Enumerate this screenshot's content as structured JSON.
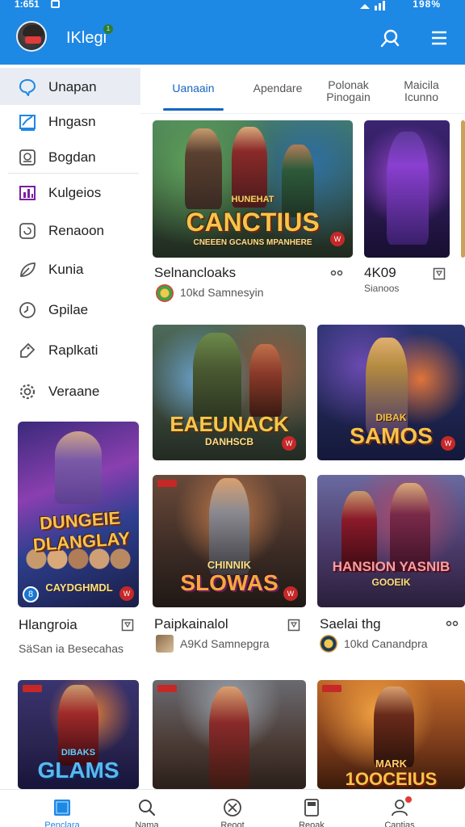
{
  "status_bar": {
    "time": "1:651",
    "battery": "198%"
  },
  "app_bar": {
    "app_name": "IKlegi",
    "badge": "1"
  },
  "sidebar": {
    "items": [
      {
        "label": "Unapan",
        "icon": "chat-bubble-icon",
        "active": true
      },
      {
        "label": "Hngasn",
        "icon": "edit-chart-icon"
      },
      {
        "label": "Bogdan",
        "icon": "image-frame-icon"
      },
      {
        "label": "Kulgeios",
        "icon": "bar-chart-icon"
      },
      {
        "label": "Renaoon",
        "icon": "refresh-square-icon"
      },
      {
        "label": "Kunia",
        "icon": "leaf-icon"
      },
      {
        "label": "Gpilae",
        "icon": "timer-icon"
      },
      {
        "label": "Raplkati",
        "icon": "tag-icon"
      },
      {
        "label": "Veraane",
        "icon": "gear-icon"
      }
    ],
    "card": {
      "art_title": "DUNGEIE DLANGLAY",
      "art_subtitle": "CAYDGHMDL",
      "badge_left": "8",
      "title": "Hlangroia",
      "subtitle": "SäSan ia Besecahas"
    }
  },
  "tabs": [
    {
      "label": "Uanaain",
      "active": true
    },
    {
      "label": "Apendare"
    },
    {
      "label": "Polonak Pinogain"
    },
    {
      "label": "Maicila Icunno"
    }
  ],
  "games": [
    {
      "art_title": "CANCTIUS",
      "art_top": "HUNEHAT",
      "art_sub": "CNEEEN GCAUNS MPANHERE",
      "badge": "W",
      "title": "Selnancloaks",
      "dev": "10kd Samnesyin",
      "action": "more"
    },
    {
      "art_title": "",
      "title": "4K09",
      "dev": "Sianoos",
      "action": "bookmark"
    },
    {
      "art_title": "EAEUNACK",
      "art_sub": "DANHSCB",
      "badge": "W"
    },
    {
      "art_title": "SAMOS",
      "art_top": "DIBAK",
      "badge": "W"
    },
    {
      "art_title": "SLOWAS",
      "art_top": "CHINNIK",
      "badge": "W",
      "title": "Paipkainalol",
      "dev": "A9Kd Samnepgra",
      "action": "bookmark"
    },
    {
      "art_title": "HANSION YASNIB",
      "art_sub": "GOOEIK",
      "title": "Saelai thg",
      "dev": "10kd Canandpra",
      "action": "more"
    },
    {
      "art_title": "GLAMS",
      "art_top": "DIBAKS"
    },
    {
      "art_title": ""
    },
    {
      "art_title": "1OOCEIUS",
      "art_top": "MARK"
    }
  ],
  "bottom_nav": [
    {
      "label": "Penclara",
      "icon": "home-square-icon",
      "active": true
    },
    {
      "label": "Nama",
      "icon": "search-icon"
    },
    {
      "label": "Reoot",
      "icon": "compass-icon"
    },
    {
      "label": "Reoak",
      "icon": "library-icon"
    },
    {
      "label": "Cantias",
      "icon": "profile-icon"
    }
  ],
  "colors": {
    "primary": "#1e88e5",
    "accent": "#1565c0",
    "badge": "#c62828"
  }
}
